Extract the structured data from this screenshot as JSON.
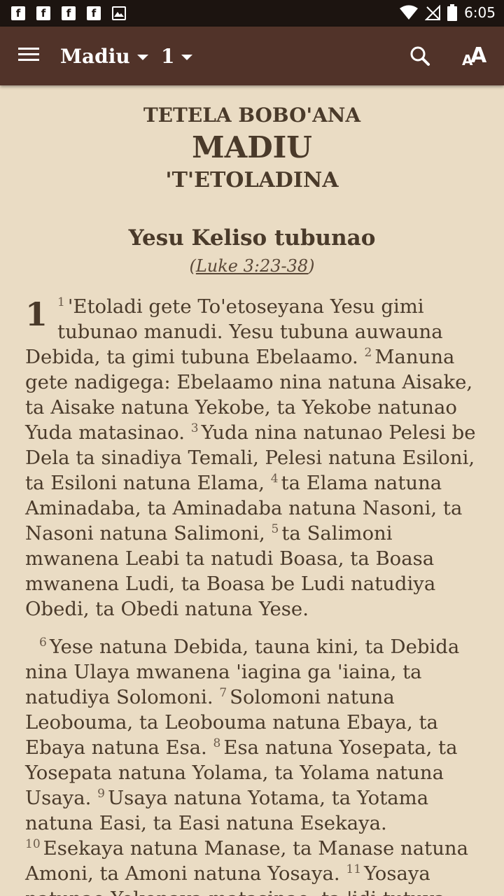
{
  "status_bar": {
    "time": "6:05",
    "notifications": [
      "facebook-icon",
      "facebook-icon",
      "facebook-icon",
      "facebook-icon",
      "image-icon"
    ],
    "notif_letter": "f"
  },
  "app_bar": {
    "book": "Madiu",
    "chapter": "1",
    "font_small": "A",
    "font_large": "A"
  },
  "header": {
    "line1": "TETELA BOBO'ANA",
    "line2": "MADIU",
    "line3": "'T'ETOLADINA"
  },
  "section": {
    "heading": "Yesu Keliso tubunao",
    "ref_open": "(",
    "ref_link": "Luke 3:23-38",
    "ref_close": ")"
  },
  "chapter_number": "1",
  "paragraphs": [
    [
      {
        "v": "1",
        "t": "'Etoladi gete To'etoseyana Yesu gimi tubunao manudi. Yesu tubuna auwauna Debida, ta gimi tubuna Ebelaamo."
      },
      {
        "v": "2",
        "t": "Manuna gete nadigega: Ebelaamo nina natuna Aisake, ta Aisake natuna Yekobe, ta Yekobe natunao Yuda matasinao."
      },
      {
        "v": "3",
        "t": "Yuda nina natunao Pelesi be Dela ta sinadiya Temali, Pelesi natuna Esiloni, ta Esiloni natuna Elama,"
      },
      {
        "v": "4",
        "t": "ta Elama natuna Aminadaba, ta Aminadaba natuna Nasoni, ta Nasoni natuna Salimoni,"
      },
      {
        "v": "5",
        "t": "ta Salimoni mwanena Leabi ta natudi Boasa, ta Boasa mwanena Ludi, ta Boasa be Ludi natudiya Obedi, ta Obedi natuna Yese."
      }
    ],
    [
      {
        "v": "6",
        "t": "Yese natuna Debida, tauna kini, ta Debida nina Ulaya mwanena 'iagina ga 'iaina, ta natudiya Solomoni."
      },
      {
        "v": "7",
        "t": "Solomoni natuna Leobouma, ta Leobouma natuna Ebaya, ta Ebaya natuna Esa."
      },
      {
        "v": "8",
        "t": "Esa natuna Yosepata, ta Yosepata natuna Yolama, ta Yolama natuna Usaya."
      },
      {
        "v": "9",
        "t": "Usaya natuna Yotama, ta Yotama natuna Easi, ta Easi natuna Esekaya."
      },
      {
        "v": "10",
        "t": "Esekaya natuna Manase, ta Manase natuna Amoni, ta Amoni natuna Yosaya."
      },
      {
        "v": "11",
        "t": "Yosaya natunao Yekonaya matasinao, ta 'idi tutuya me Babiloni"
      }
    ]
  ]
}
